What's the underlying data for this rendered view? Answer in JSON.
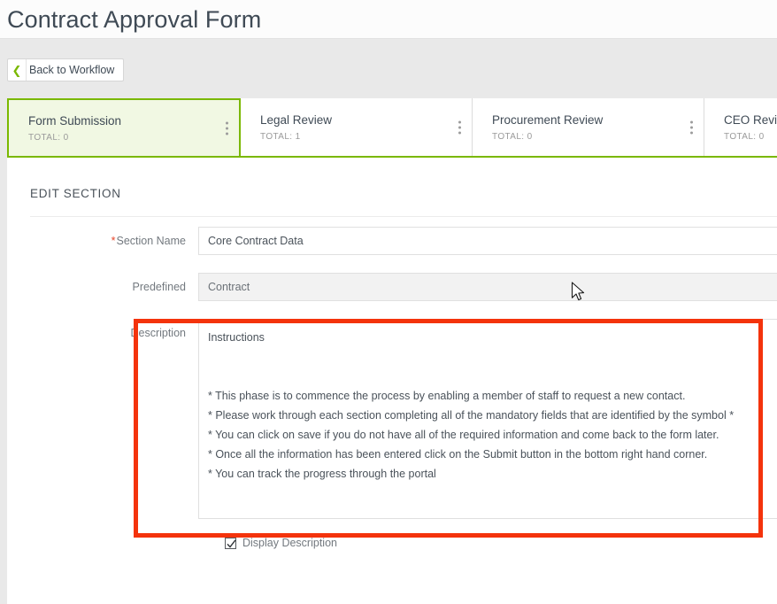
{
  "header": {
    "title": "Contract Approval Form"
  },
  "toolbar": {
    "back_label": "Back to Workflow",
    "back_icon": "chevron-left-icon"
  },
  "tabs": [
    {
      "name": "Form Submission",
      "total": "TOTAL: 0",
      "active": true,
      "menu_icon": "kebab-menu-icon"
    },
    {
      "name": "Legal Review",
      "total": "TOTAL: 1",
      "active": false,
      "menu_icon": "kebab-menu-icon"
    },
    {
      "name": "Procurement Review",
      "total": "TOTAL: 0",
      "active": false,
      "menu_icon": "kebab-menu-icon"
    },
    {
      "name": "CEO Review",
      "total": "TOTAL: 0",
      "active": false,
      "menu_icon": "kebab-menu-icon"
    }
  ],
  "main": {
    "section_heading": "EDIT SECTION",
    "fields": {
      "section_name": {
        "label": "Section Name",
        "required_marker": "*",
        "value": "Core Contract Data",
        "placeholder": ""
      },
      "predefined": {
        "label": "Predefined",
        "value": "Contract",
        "placeholder": "",
        "disabled": true
      },
      "description": {
        "label": "Description",
        "value": "Instructions\n\n\n* This phase is to commence the process by enabling a member of staff to request a new contact.\n* Please work through each section completing all of the mandatory fields that are identified by the symbol *\n* You can click on save if you do not have all of the required information and come back to the form later.\n* Once all the information has been entered click on the Submit button in the bottom right hand corner.\n* You can track the progress through the portal",
        "placeholder": ""
      }
    },
    "display_description": {
      "label": "Display Description",
      "checked": true
    }
  },
  "annotation": {
    "color": "#f4330c",
    "target": "description-field"
  },
  "colors": {
    "accent_green": "#7ab800",
    "active_tab_bg": "#f1f8e3",
    "required_red": "#e8472b",
    "annotation_red": "#f4330c",
    "toolbar_grey": "#e9e9e9"
  }
}
